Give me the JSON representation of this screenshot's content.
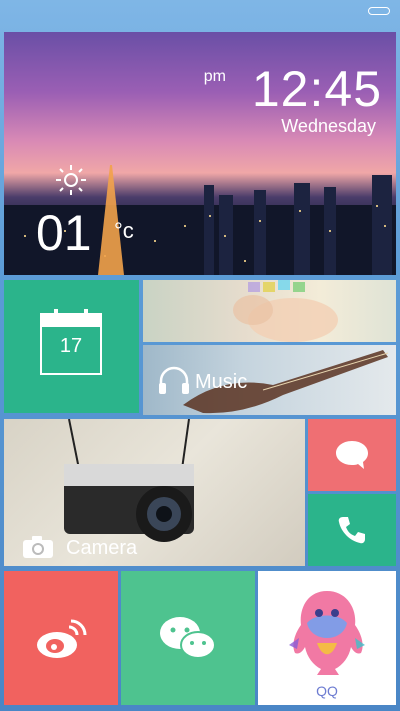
{
  "weather": {
    "period": "pm",
    "time": "12:45",
    "day": "Wednesday",
    "temperature": "01",
    "unit": "°c",
    "icon": "sun-icon"
  },
  "calendar": {
    "date": "17",
    "icon": "calendar-icon"
  },
  "music": {
    "label": "Music",
    "icon": "headphones-icon"
  },
  "camera": {
    "label": "Camera",
    "icon": "camera-icon"
  },
  "messages": {
    "icon": "chat-bubble-icon"
  },
  "phone": {
    "icon": "phone-icon"
  },
  "weibo": {
    "icon": "weibo-icon"
  },
  "wechat": {
    "icon": "wechat-icon"
  },
  "qq": {
    "label": "QQ",
    "icon": "qq-penguin-icon"
  },
  "colors": {
    "green": "#2bb48b",
    "red": "#ef6f73",
    "weibo_red": "#f1625f",
    "wechat_green": "#4ec38f"
  }
}
